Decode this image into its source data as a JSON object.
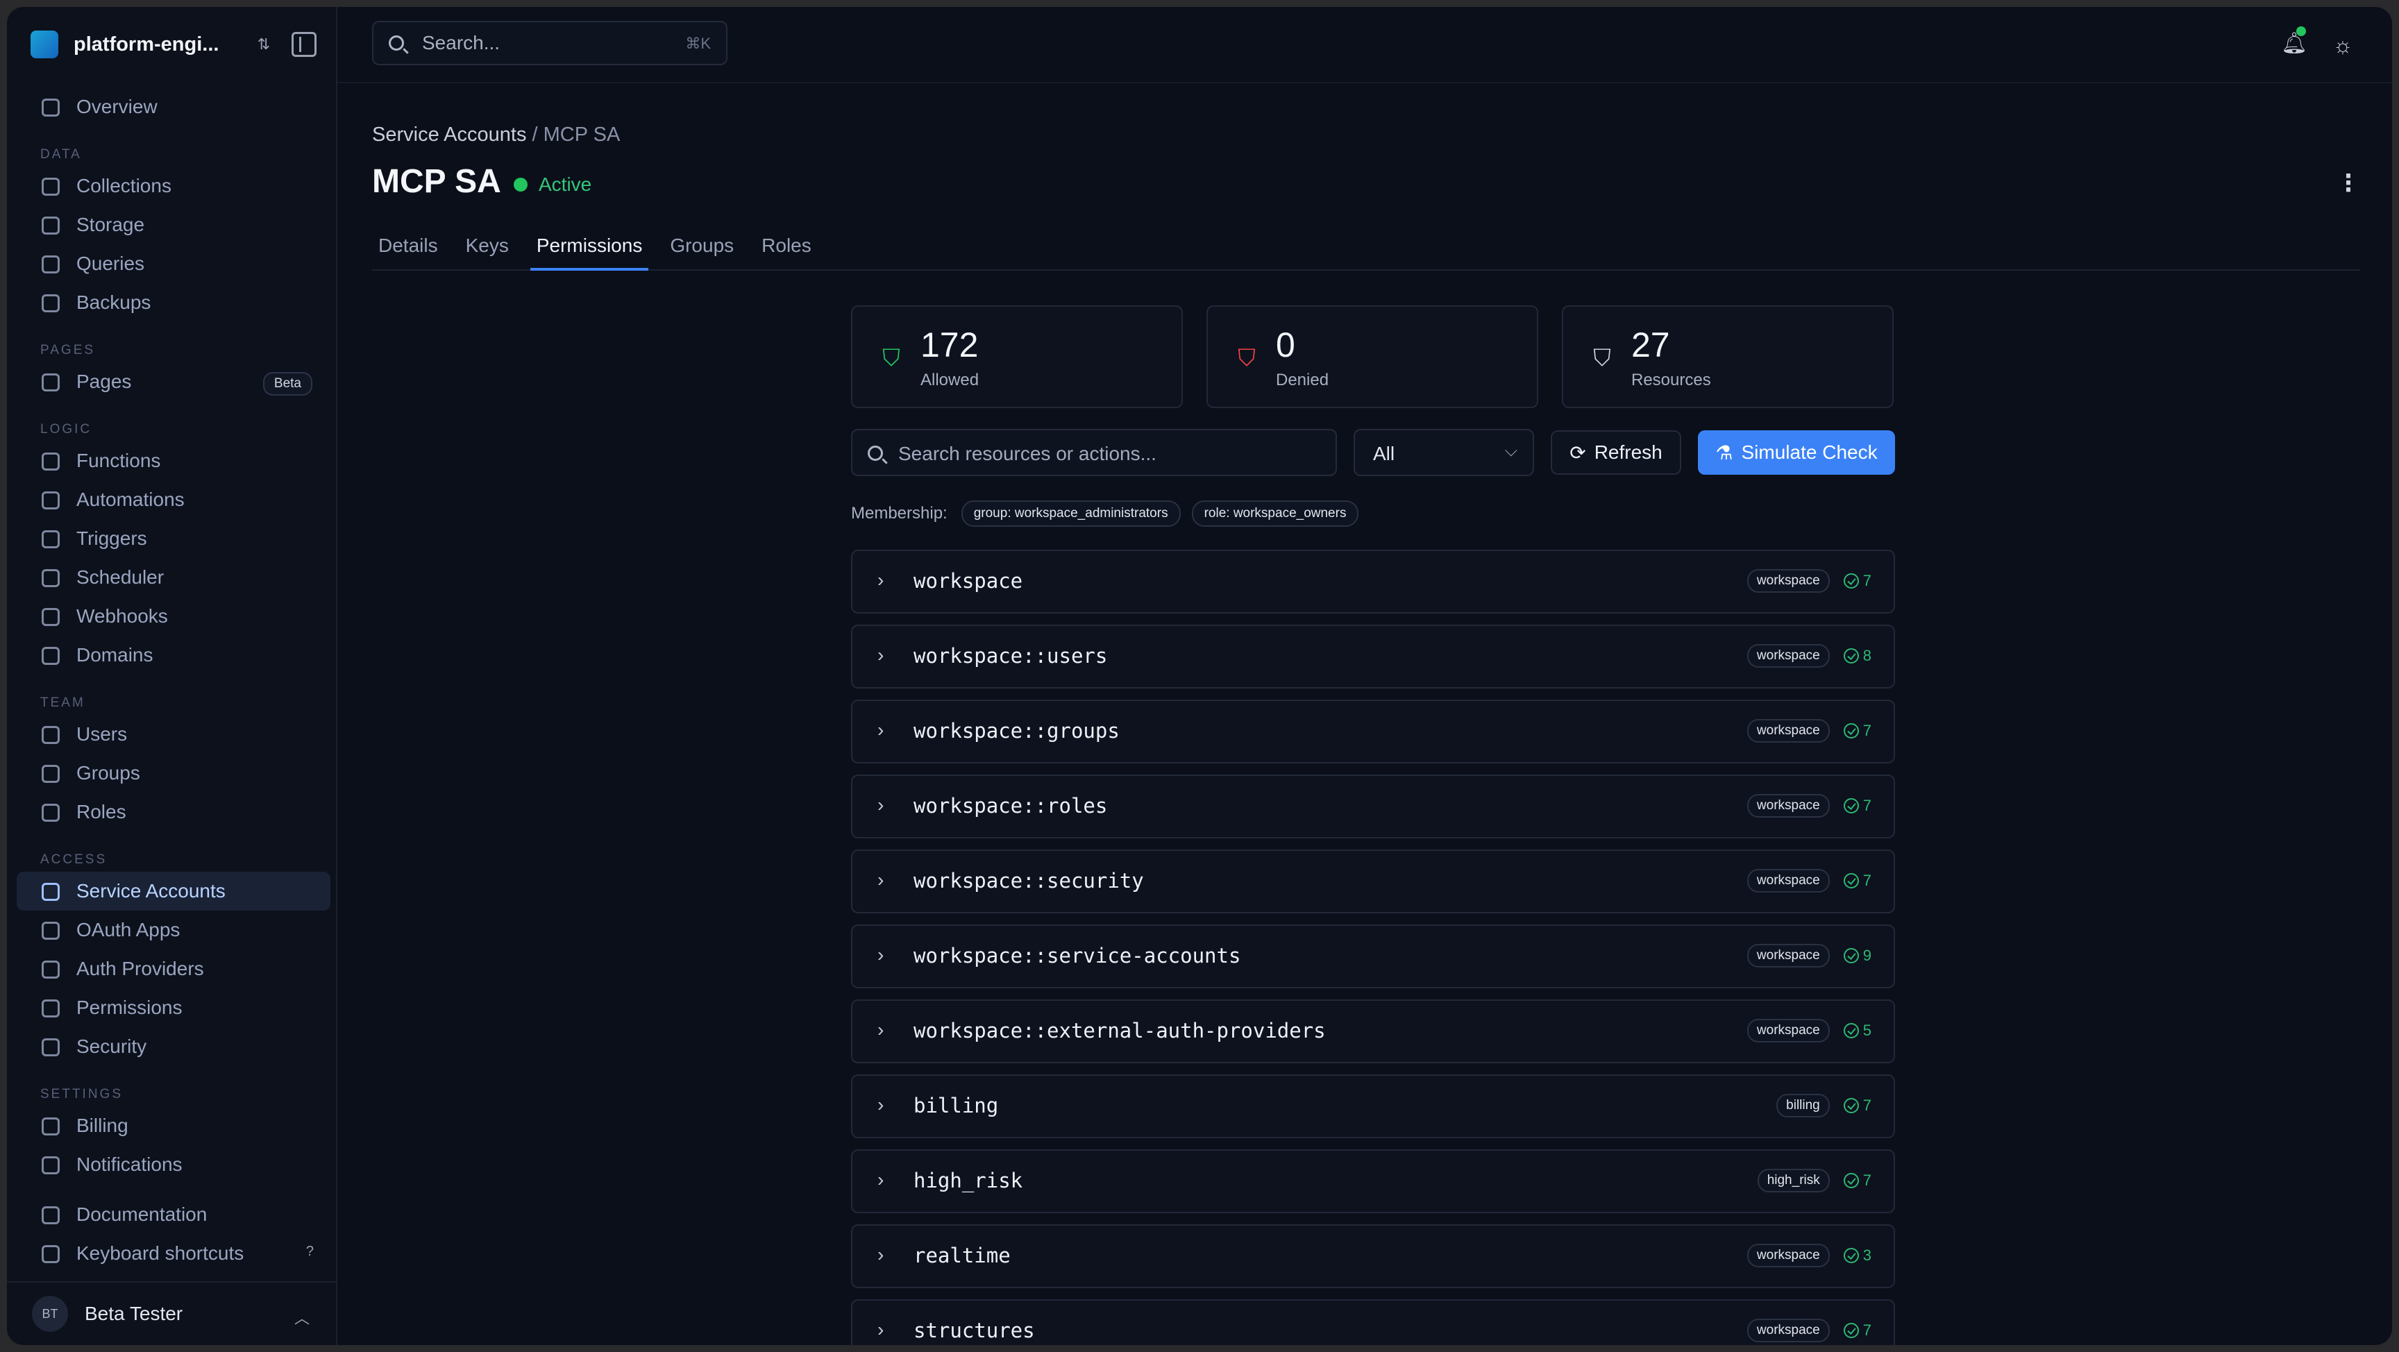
{
  "workspace": {
    "name": "platform-engi..."
  },
  "sidebar": {
    "top": [
      {
        "label": "Overview",
        "icon": "grid-icon"
      }
    ],
    "sections": [
      {
        "title": "DATA",
        "items": [
          {
            "label": "Collections",
            "icon": "database-icon"
          },
          {
            "label": "Storage",
            "icon": "storage-icon"
          },
          {
            "label": "Queries",
            "icon": "query-icon"
          },
          {
            "label": "Backups",
            "icon": "archive-icon"
          }
        ]
      },
      {
        "title": "PAGES",
        "items": [
          {
            "label": "Pages",
            "icon": "page-icon",
            "badge": "Beta"
          }
        ]
      },
      {
        "title": "LOGIC",
        "items": [
          {
            "label": "Functions",
            "icon": "braces-icon"
          },
          {
            "label": "Automations",
            "icon": "workflow-icon"
          },
          {
            "label": "Triggers",
            "icon": "bolt-icon"
          },
          {
            "label": "Scheduler",
            "icon": "calendar-icon"
          },
          {
            "label": "Webhooks",
            "icon": "webhook-icon"
          },
          {
            "label": "Domains",
            "icon": "globe-icon"
          }
        ]
      },
      {
        "title": "TEAM",
        "items": [
          {
            "label": "Users",
            "icon": "users-icon"
          },
          {
            "label": "Groups",
            "icon": "group-icon"
          },
          {
            "label": "Roles",
            "icon": "shield-icon"
          }
        ]
      },
      {
        "title": "ACCESS",
        "items": [
          {
            "label": "Service Accounts",
            "icon": "key-icon",
            "active": true
          },
          {
            "label": "OAuth Apps",
            "icon": "window-icon"
          },
          {
            "label": "Auth Providers",
            "icon": "login-icon"
          },
          {
            "label": "Permissions",
            "icon": "shield-check-icon"
          },
          {
            "label": "Security",
            "icon": "shield-alert-icon"
          }
        ]
      },
      {
        "title": "SETTINGS",
        "items": [
          {
            "label": "Billing",
            "icon": "credit-card-icon"
          },
          {
            "label": "Notifications",
            "icon": "bell-icon"
          }
        ]
      }
    ],
    "bottom": [
      {
        "label": "Documentation",
        "icon": "book-icon"
      },
      {
        "label": "Keyboard shortcuts",
        "icon": "keyboard-icon",
        "shortcut": "?"
      }
    ],
    "user": {
      "initials": "BT",
      "name": "Beta Tester"
    }
  },
  "topbar": {
    "search_placeholder": "Search...",
    "search_shortcut": "⌘K"
  },
  "page": {
    "breadcrumb_parent": "Service Accounts",
    "breadcrumb_sep": " / ",
    "breadcrumb_current": "MCP SA",
    "title": "MCP SA",
    "status": "Active",
    "tabs": [
      "Details",
      "Keys",
      "Permissions",
      "Groups",
      "Roles"
    ],
    "active_tab": "Permissions"
  },
  "stats": [
    {
      "value": "172",
      "label": "Allowed",
      "icon": "shield-check-icon",
      "color": "#22c55e"
    },
    {
      "value": "0",
      "label": "Denied",
      "icon": "shield-x-icon",
      "color": "#ef4444"
    },
    {
      "value": "27",
      "label": "Resources",
      "icon": "shield-icon",
      "color": "#c7cddb"
    }
  ],
  "controls": {
    "search_placeholder": "Search resources or actions...",
    "filter_value": "All",
    "refresh_label": "Refresh",
    "simulate_label": "Simulate Check"
  },
  "membership": {
    "label": "Membership:",
    "chips": [
      "group: workspace_administrators",
      "role: workspace_owners"
    ]
  },
  "resources": [
    {
      "name": "workspace",
      "tag": "workspace",
      "count": "7"
    },
    {
      "name": "workspace::users",
      "tag": "workspace",
      "count": "8"
    },
    {
      "name": "workspace::groups",
      "tag": "workspace",
      "count": "7"
    },
    {
      "name": "workspace::roles",
      "tag": "workspace",
      "count": "7"
    },
    {
      "name": "workspace::security",
      "tag": "workspace",
      "count": "7"
    },
    {
      "name": "workspace::service-accounts",
      "tag": "workspace",
      "count": "9"
    },
    {
      "name": "workspace::external-auth-providers",
      "tag": "workspace",
      "count": "5"
    },
    {
      "name": "billing",
      "tag": "billing",
      "count": "7"
    },
    {
      "name": "high_risk",
      "tag": "high_risk",
      "count": "7"
    },
    {
      "name": "realtime",
      "tag": "workspace",
      "count": "3"
    },
    {
      "name": "structures",
      "tag": "workspace",
      "count": "7"
    }
  ],
  "colors": {
    "accent": "#3b82f6",
    "success": "#22c55e",
    "danger": "#ef4444",
    "background": "#0b0f1a"
  }
}
